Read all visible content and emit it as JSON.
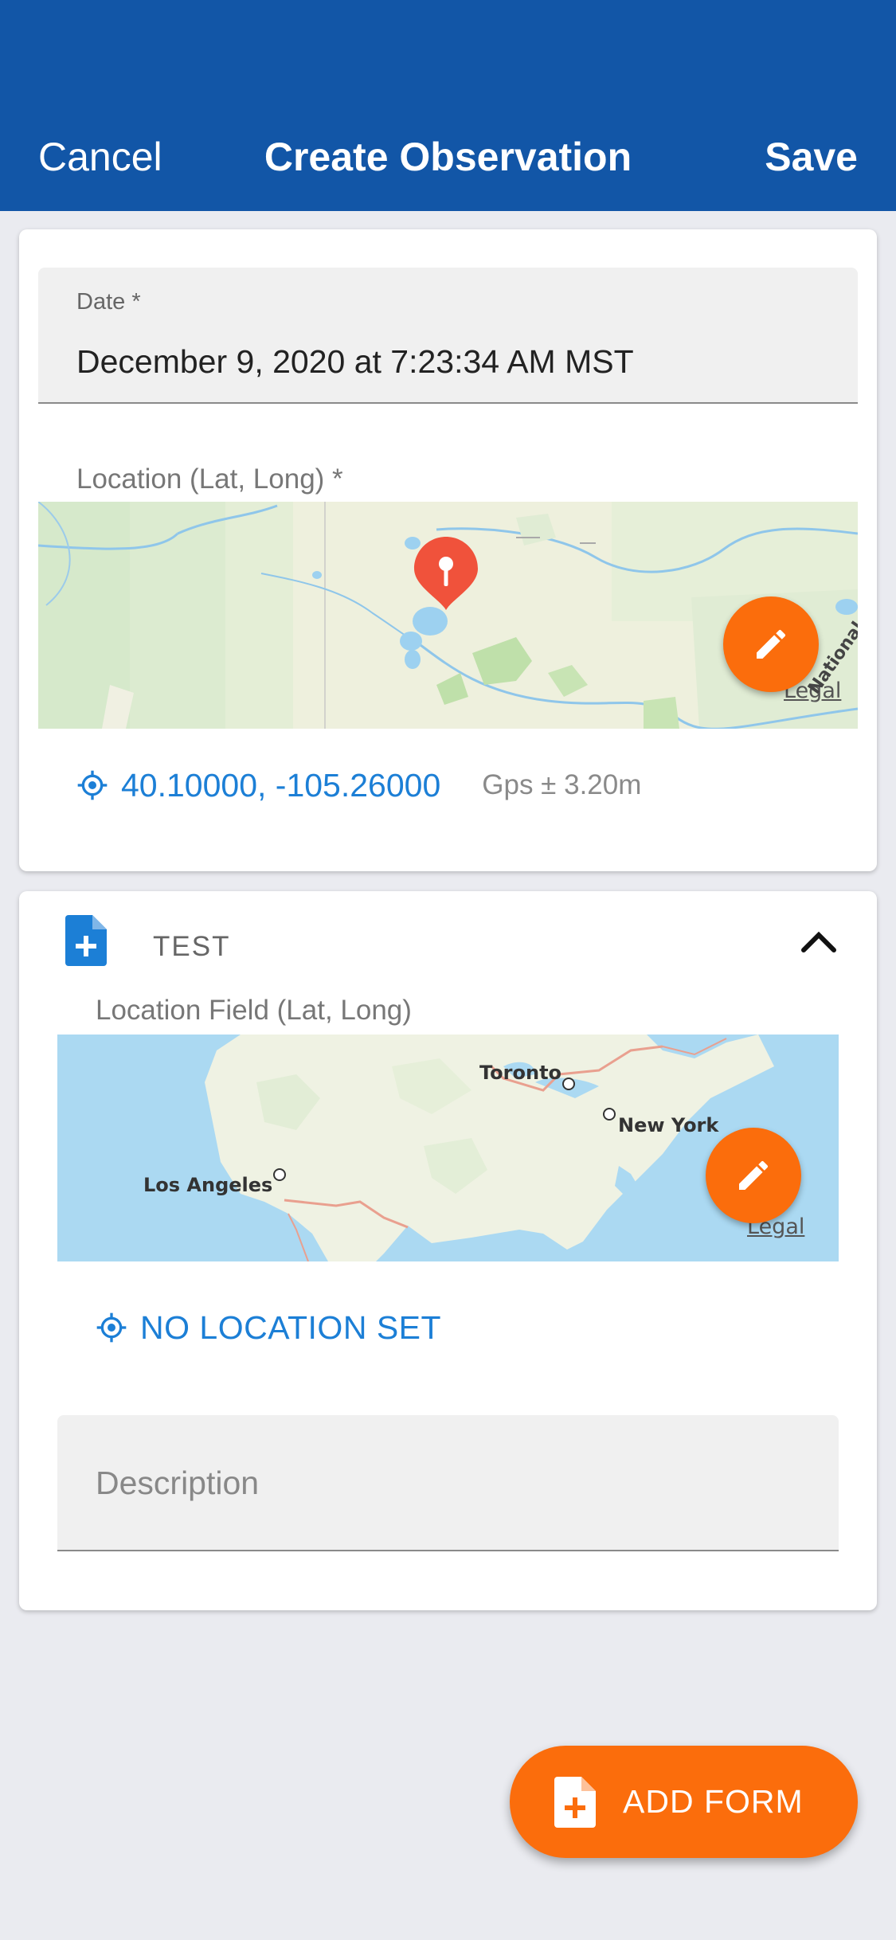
{
  "header": {
    "cancel_label": "Cancel",
    "title": "Create Observation",
    "save_label": "Save"
  },
  "observation": {
    "date_label": "Date *",
    "date_value": "December 9, 2020 at 7:23:34 AM MST",
    "location_label": "Location (Lat, Long) *",
    "map_legal": "Legal",
    "map_road_label": "National Hwy",
    "coordinates": "40.10000, -105.26000",
    "gps_accuracy": "Gps ± 3.20m"
  },
  "form": {
    "title": "TEST",
    "location_field_label": "Location Field (Lat, Long)",
    "map_cities": [
      "Toronto",
      "New York",
      "Los Angeles"
    ],
    "map_legal": "Legal",
    "no_location_label": "NO LOCATION SET",
    "description_placeholder": "Description"
  },
  "add_form_label": "ADD FORM",
  "colors": {
    "header": "#1256a7",
    "accent": "#fb6d0c",
    "link_blue": "#1c7fd6",
    "background": "#eaebf0"
  },
  "icons": [
    "pencil-icon",
    "crosshair-icon",
    "form-add-icon",
    "chevron-up-icon",
    "map-pin-icon"
  ]
}
